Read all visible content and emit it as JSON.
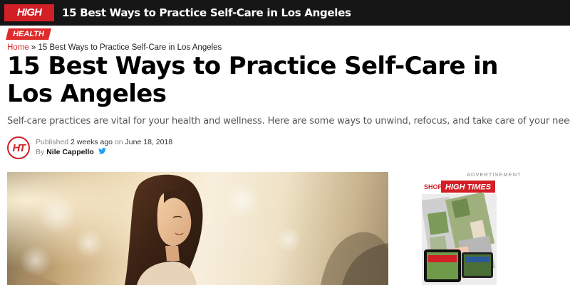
{
  "topbar": {
    "logo_text": "HIGH TIMES",
    "title": "15 Best Ways to Practice Self-Care in Los Angeles"
  },
  "article": {
    "category": "HEALTH",
    "breadcrumb": {
      "home": "Home",
      "separator": "»",
      "current": "15 Best Ways to Practice Self-Care in Los Angeles"
    },
    "headline": "15 Best Ways to Practice Self-Care in Los Angeles",
    "dek": "Self-care practices are vital for your health and wellness. Here are some ways to unwind, refocus, and take care of your needs.",
    "avatar_text": "HT",
    "published_prefix": "Published",
    "published_relative": "2 weeks ago",
    "published_on": "on",
    "published_date": "June 18, 2018",
    "by_prefix": "By",
    "author": "Nile Cappello"
  },
  "ad": {
    "label": "ADVERTISEMENT",
    "shop_text": "SHOP",
    "brand_text": "HIGH TIMES"
  },
  "colors": {
    "brand_red": "#d31f26",
    "category_red": "#e02b2b",
    "topbar_bg": "#161616",
    "twitter_blue": "#1da1f2"
  },
  "icons": {
    "twitter": "twitter-icon"
  }
}
